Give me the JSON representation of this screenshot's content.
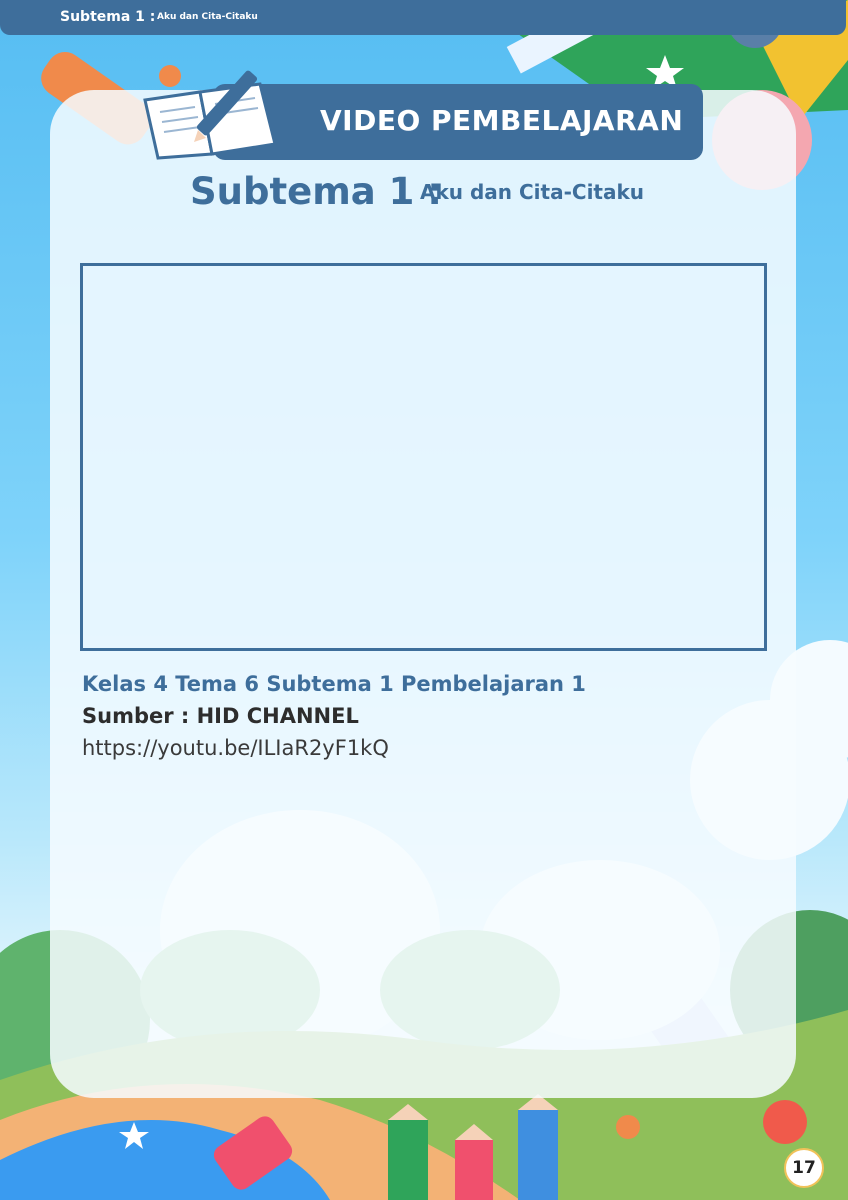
{
  "header": {
    "subtema_label": "Subtema 1 :",
    "subtema_title": "Aku dan Cita-Citaku"
  },
  "banner": {
    "title": "VIDEO PEMBELAJARAN",
    "icon": "open-book-pencil-icon"
  },
  "heading": {
    "subtema_label": "Subtema 1 :",
    "subtema_title": "Aku dan Cita-Citaku"
  },
  "video": {
    "title": "Kelas 4 Tema 6 Subtema 1 Pembelajaran 1",
    "source": "Sumber : HID CHANNEL",
    "link": "https://youtu.be/ILIaR2yF1kQ"
  },
  "footer": {
    "page_number": "17"
  },
  "colors": {
    "primary": "#3e6e9b",
    "background_top": "#56bdf2",
    "page_badge_border": "#f1c25a"
  }
}
